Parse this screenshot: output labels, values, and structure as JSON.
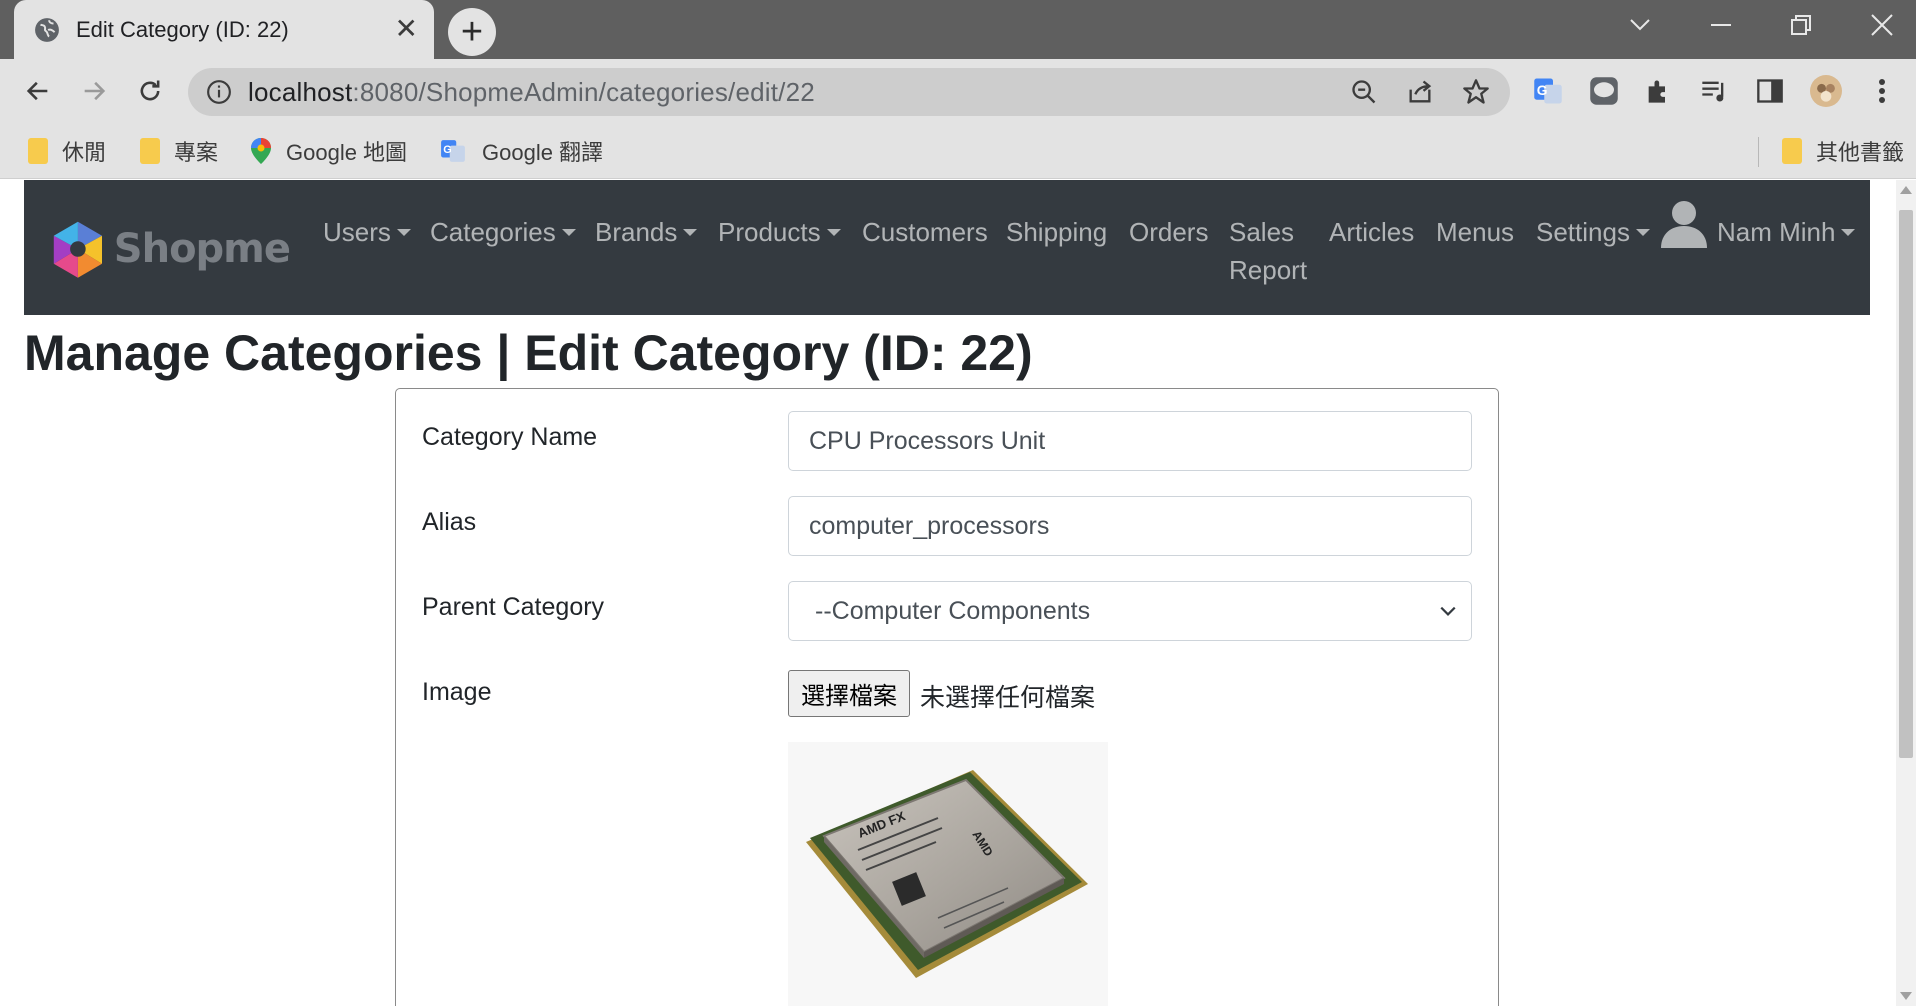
{
  "browser": {
    "tab_title": "Edit Category (ID: 22)",
    "url_host": "localhost",
    "url_path": ":8080/ShopmeAdmin/categories/edit/22",
    "bookmarks": [
      "休閒",
      "專案",
      "Google 地圖",
      "Google 翻譯"
    ],
    "other_bookmarks": "其他書籤"
  },
  "site": {
    "brand": "Shopme",
    "nav": {
      "users": "Users",
      "categories": "Categories",
      "brands": "Brands",
      "products": "Products",
      "customers": "Customers",
      "shipping": "Shipping",
      "orders": "Orders",
      "sales_line1": "Sales",
      "sales_line2": "Report",
      "articles": "Articles",
      "menus": "Menus",
      "settings": "Settings",
      "user_name": "Nam Minh"
    },
    "nav_bg": "#343a40"
  },
  "page": {
    "title": "Manage Categories | Edit Category (ID: 22)"
  },
  "form": {
    "name_label": "Category Name",
    "name_value": "CPU Processors Unit",
    "alias_label": "Alias",
    "alias_value": "computer_processors",
    "parent_label": "Parent Category",
    "parent_value": "--Computer Components",
    "image_label": "Image",
    "file_button": "選擇檔案",
    "file_status": "未選擇任何檔案",
    "chip_print": [
      "AMD FX",
      "AMD"
    ]
  }
}
